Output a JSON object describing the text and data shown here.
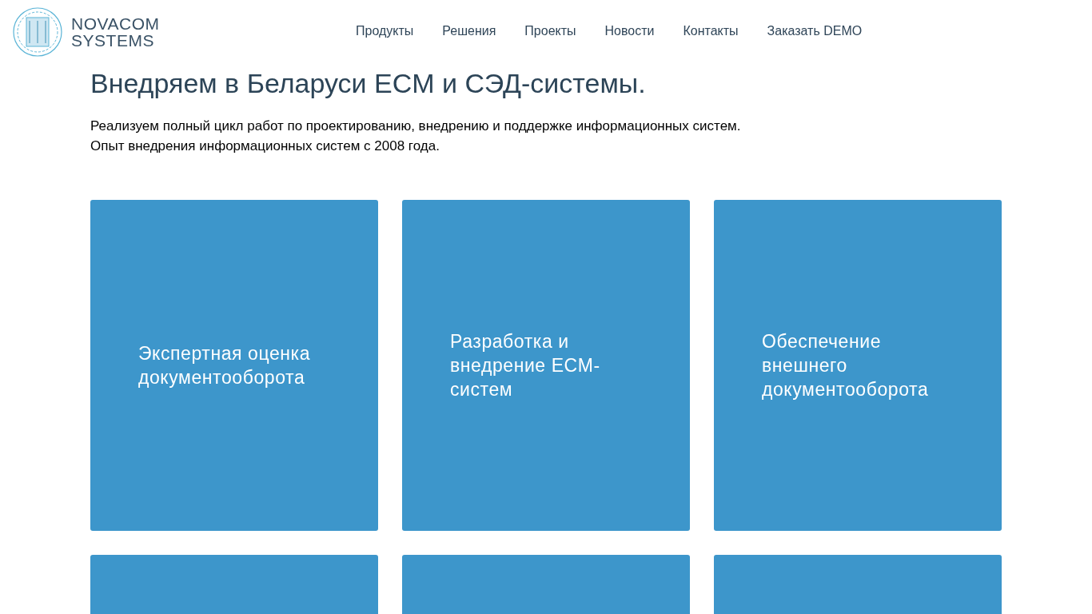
{
  "logo": {
    "line1": "NOVACOM",
    "line2": "SYSTEMS"
  },
  "nav": [
    "Продукты",
    "Решения",
    "Проекты",
    "Новости",
    "Контакты",
    "Заказать DEMO"
  ],
  "heading": "Внедряем в Беларуси ECM и СЭД-системы.",
  "intro": [
    "Реализуем полный цикл работ по проектированию, внедрению и поддержке информационных систем.",
    "Опыт внедрения информационных систем с 2008 года."
  ],
  "cards": [
    {
      "kind": "titled",
      "title": "Экспертная оценка документооборота"
    },
    {
      "kind": "titled",
      "title": "Разработка и внедрение ECM-систем"
    },
    {
      "kind": "titled",
      "title": "Обеспечение внешнего документооборота"
    },
    {
      "kind": "blank"
    },
    {
      "kind": "blank"
    },
    {
      "kind": "blank"
    }
  ]
}
